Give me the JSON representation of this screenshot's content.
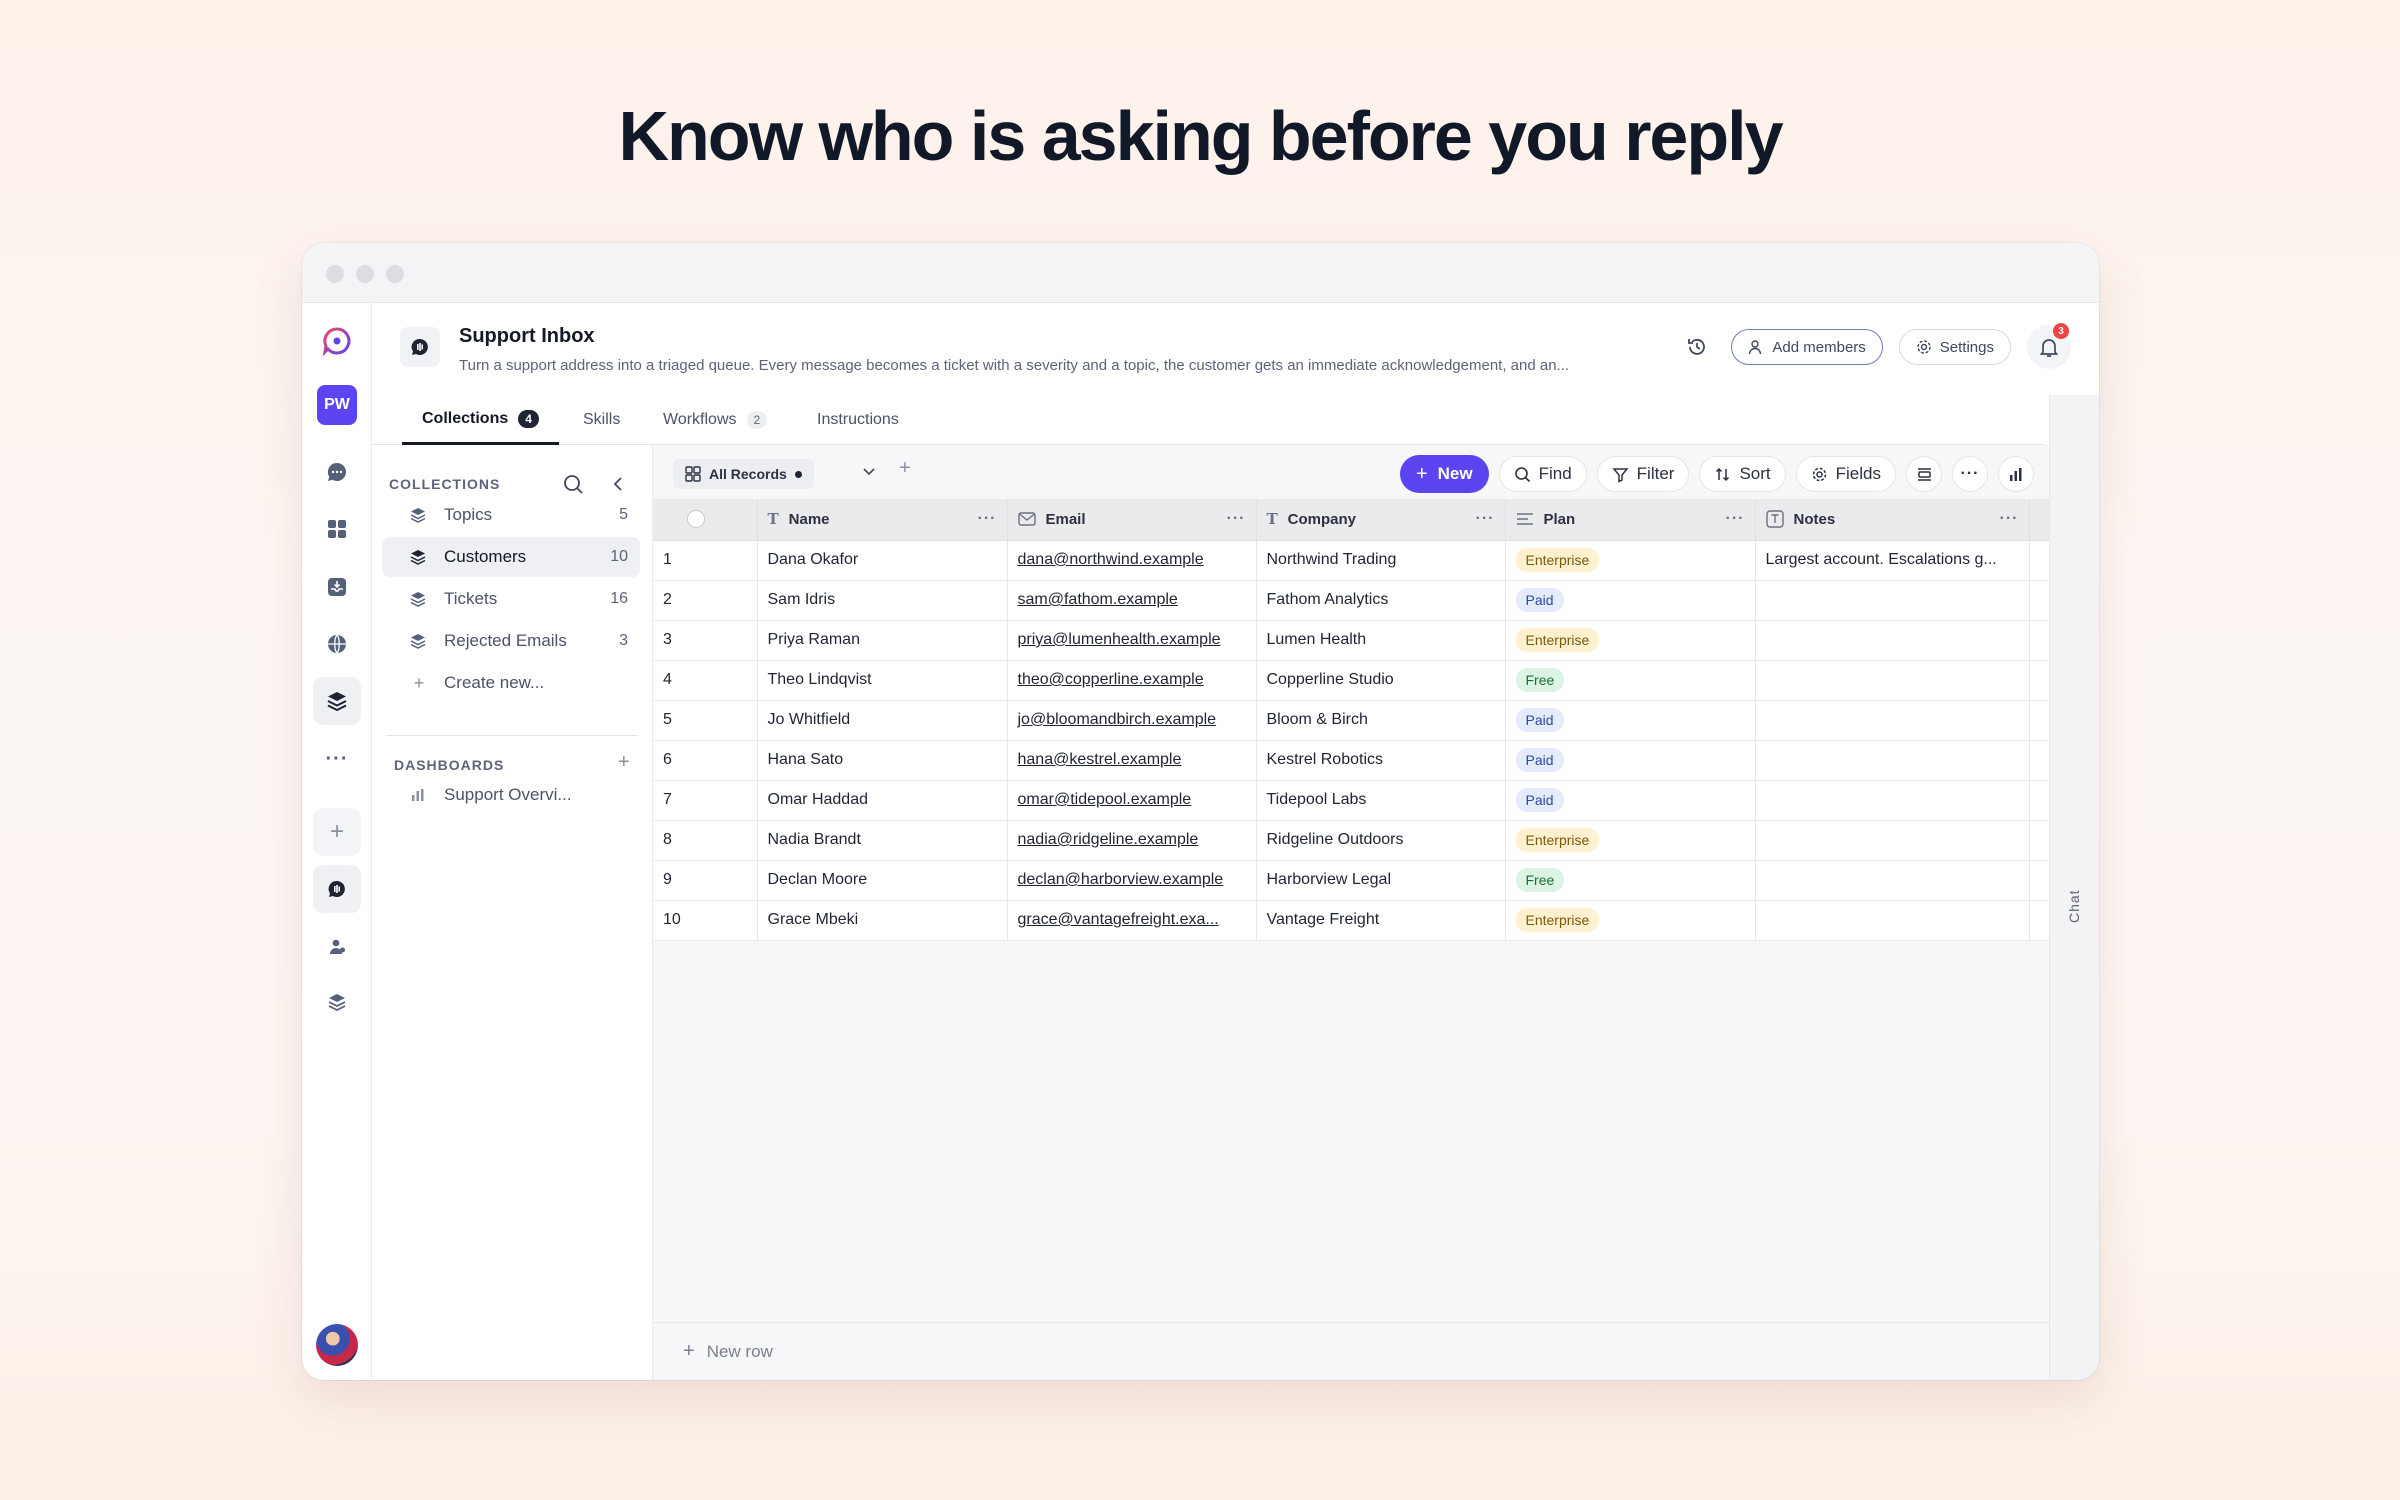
{
  "headline": "Know who is asking before you reply",
  "app": {
    "title": "Support Inbox",
    "description": "Turn a support address into a triaged queue. Every message becomes a ticket with a severity and a topic, the customer gets an immediate acknowledgement, and an...",
    "add_members": "Add members",
    "settings": "Settings",
    "notifications_count": "3",
    "workspace_initials": "PW"
  },
  "tabs": [
    {
      "label": "Collections",
      "count": "4"
    },
    {
      "label": "Skills"
    },
    {
      "label": "Workflows",
      "count": "2"
    },
    {
      "label": "Instructions"
    }
  ],
  "sidebar": {
    "collections_heading": "COLLECTIONS",
    "items": [
      {
        "label": "Topics",
        "count": "5"
      },
      {
        "label": "Customers",
        "count": "10"
      },
      {
        "label": "Tickets",
        "count": "16"
      },
      {
        "label": "Rejected Emails",
        "count": "3"
      }
    ],
    "create_new": "Create new...",
    "dashboards_heading": "DASHBOARDS",
    "dashboards": [
      {
        "label": "Support Overvi..."
      }
    ]
  },
  "toolbar": {
    "view_label": "All Records",
    "new": "New",
    "find": "Find",
    "filter": "Filter",
    "sort": "Sort",
    "fields": "Fields"
  },
  "columns": [
    "Name",
    "Email",
    "Company",
    "Plan",
    "Notes"
  ],
  "rows": [
    {
      "n": "1",
      "name": "Dana Okafor",
      "email": "dana@northwind.example",
      "company": "Northwind Trading",
      "plan": "Enterprise",
      "notes": "Largest account. Escalations g..."
    },
    {
      "n": "2",
      "name": "Sam Idris",
      "email": "sam@fathom.example",
      "company": "Fathom Analytics",
      "plan": "Paid",
      "notes": ""
    },
    {
      "n": "3",
      "name": "Priya Raman",
      "email": "priya@lumenhealth.example",
      "company": "Lumen Health",
      "plan": "Enterprise",
      "notes": ""
    },
    {
      "n": "4",
      "name": "Theo Lindqvist",
      "email": "theo@copperline.example",
      "company": "Copperline Studio",
      "plan": "Free",
      "notes": ""
    },
    {
      "n": "5",
      "name": "Jo Whitfield",
      "email": "jo@bloomandbirch.example",
      "company": "Bloom & Birch",
      "plan": "Paid",
      "notes": ""
    },
    {
      "n": "6",
      "name": "Hana Sato",
      "email": "hana@kestrel.example",
      "company": "Kestrel Robotics",
      "plan": "Paid",
      "notes": ""
    },
    {
      "n": "7",
      "name": "Omar Haddad",
      "email": "omar@tidepool.example",
      "company": "Tidepool Labs",
      "plan": "Paid",
      "notes": ""
    },
    {
      "n": "8",
      "name": "Nadia Brandt",
      "email": "nadia@ridgeline.example",
      "company": "Ridgeline Outdoors",
      "plan": "Enterprise",
      "notes": ""
    },
    {
      "n": "9",
      "name": "Declan Moore",
      "email": "declan@harborview.example",
      "company": "Harborview Legal",
      "plan": "Free",
      "notes": ""
    },
    {
      "n": "10",
      "name": "Grace Mbeki",
      "email": "grace@vantagefreight.exa...",
      "company": "Vantage Freight",
      "plan": "Enterprise",
      "notes": ""
    }
  ],
  "new_row": "New row",
  "chat_label": "Chat",
  "colors": {
    "accent": "#5b45f0",
    "link": "#3a54c9",
    "badge": "#ef4444"
  }
}
